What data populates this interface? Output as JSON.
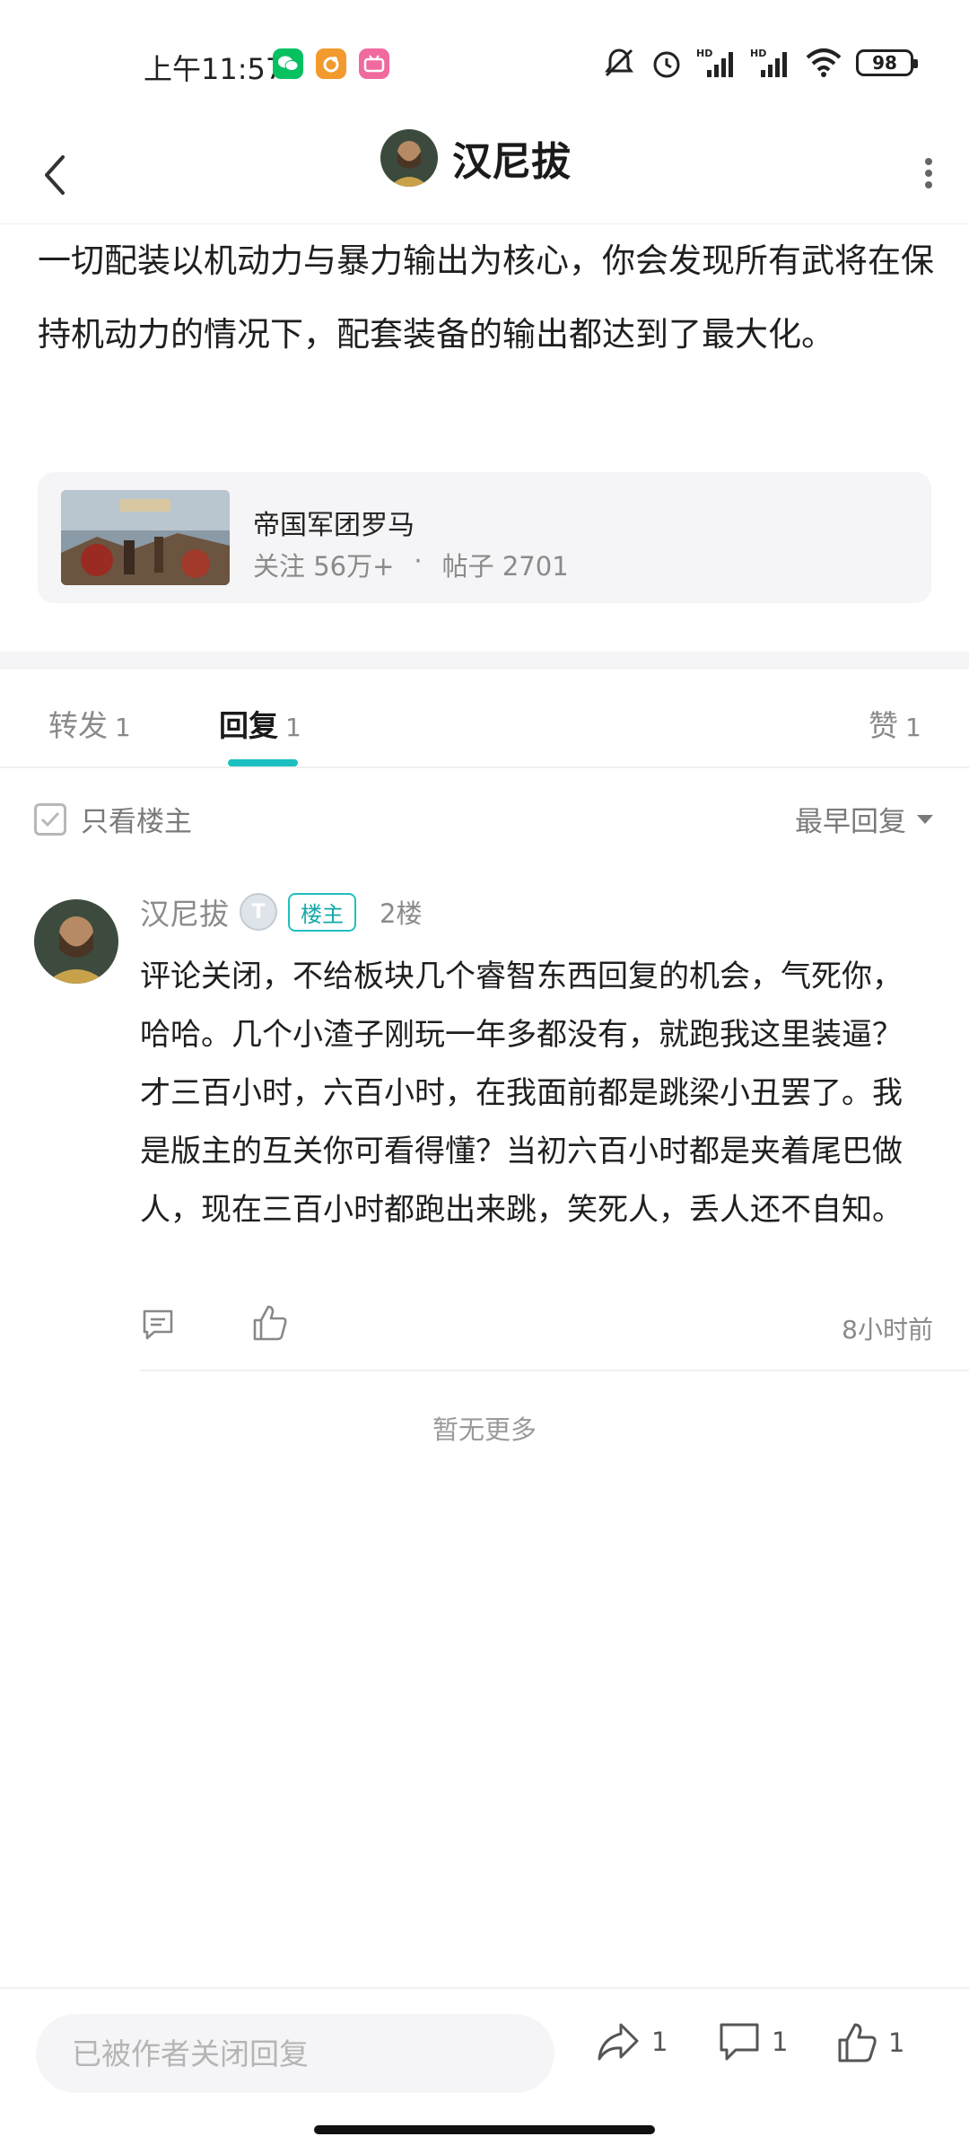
{
  "status_bar": {
    "time": "上午11:57",
    "battery": "98",
    "apps": [
      "wechat-icon",
      "uc-icon",
      "bilibili-icon"
    ]
  },
  "header": {
    "title": "汉尼拔"
  },
  "post": {
    "text": "一切配装以机动力与暴力输出为核心，你会发现所有武将在保持机动力的情况下，配套装备的输出都达到了最大化。"
  },
  "forum": {
    "name": "帝国军团罗马",
    "followers": "关注 56万+",
    "dot": "·",
    "posts": "帖子 2701"
  },
  "tabs": [
    {
      "label": "转发",
      "count": "1"
    },
    {
      "label": "回复",
      "count": "1"
    },
    {
      "label": "赞",
      "count": "1"
    }
  ],
  "filter": {
    "only_op_label": "只看楼主",
    "sort_label": "最早回复"
  },
  "comment": {
    "user": "汉尼拔",
    "level": "T",
    "op_badge": "楼主",
    "floor": "2楼",
    "text": "评论关闭，不给板块几个睿智东西回复的机会，气死你，哈哈。几个小渣子刚玩一年多都没有，就跑我这里装逼？才三百小时，六百小时，在我面前都是跳梁小丑罢了。我是版主的互关你可看得懂？当初六百小时都是夹着尾巴做人，现在三百小时都跑出来跳，笑死人，丢人还不自知。",
    "time": "8小时前"
  },
  "list_end": "暂无更多",
  "bottom_bar": {
    "input_placeholder": "已被作者关闭回复",
    "share_count": "1",
    "comment_count": "1",
    "like_count": "1"
  },
  "colors": {
    "accent": "#1cc0c0",
    "muted_text": "#8a8a8a"
  }
}
